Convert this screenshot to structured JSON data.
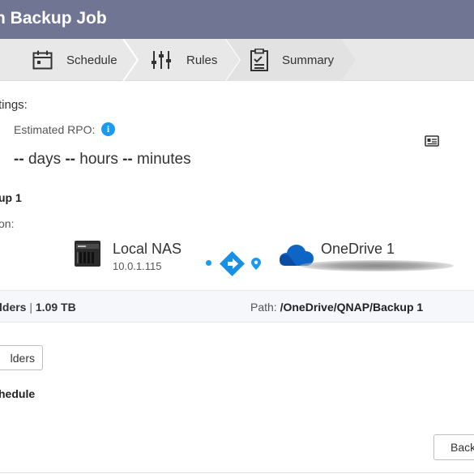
{
  "window": {
    "title": "n Backup Job"
  },
  "steps": [
    {
      "label": "Schedule",
      "icon": "calendar-icon"
    },
    {
      "label": "Rules",
      "icon": "sliders-icon"
    },
    {
      "label": "Summary",
      "icon": "checklist-icon"
    }
  ],
  "settings": {
    "heading": "tings:",
    "rpo_label": "Estimated RPO:",
    "rpo_value": {
      "days_value": "--",
      "days_unit": "days",
      "hours_value": "--",
      "hours_unit": "hours",
      "minutes_value": "--",
      "minutes_unit": "minutes"
    }
  },
  "job": {
    "name": "up 1",
    "direction_label": "on:",
    "source": {
      "name": "Local NAS",
      "ip": "10.0.1.115",
      "icon": "nas-device-icon"
    },
    "destination": {
      "name": "OneDrive 1",
      "icon": "onedrive-cloud-icon"
    },
    "colors": {
      "accent": "#1a9bef",
      "onedrive": "#0f65c6",
      "titlebar": "#6f7593"
    }
  },
  "summary_bar": {
    "folders_text": "lders",
    "separator": "|",
    "size": "1.09 TB",
    "path_label": "Path:",
    "path_value": "/OneDrive/QNAP/Backup 1"
  },
  "buttons": {
    "folders": "lders",
    "back": "Back"
  },
  "schedule": {
    "heading": "hedule"
  }
}
